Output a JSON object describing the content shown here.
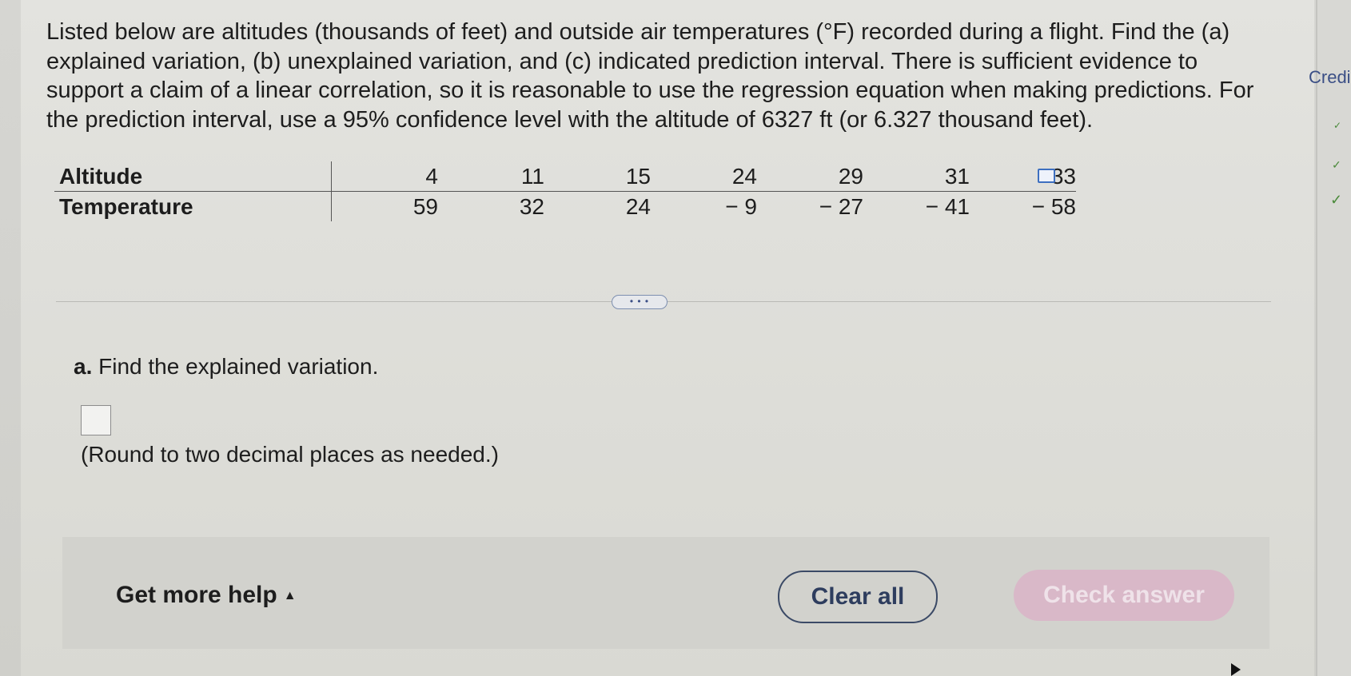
{
  "question": {
    "text": "Listed below are altitudes (thousands of feet) and outside air temperatures (°F) recorded during a flight. Find the (a) explained variation, (b) unexplained variation, and (c) indicated prediction interval. There is sufficient evidence to support a claim of a linear correlation, so it is reasonable to use the regression equation when making predictions. For the prediction interval, use a 95% confidence level with the altitude of 6327 ft (or 6.327 thousand feet)."
  },
  "table": {
    "rows": [
      {
        "label": "Altitude",
        "values": [
          "4",
          "11",
          "15",
          "24",
          "29",
          "31",
          "33"
        ]
      },
      {
        "label": "Temperature",
        "values": [
          "59",
          "32",
          "24",
          "− 9",
          "− 27",
          "− 41",
          "− 58"
        ]
      }
    ]
  },
  "more_button": {
    "label": "• • •"
  },
  "part_a": {
    "letter": "a.",
    "prompt": "Find the explained variation.",
    "answer_value": "",
    "note": "(Round to two decimal places as needed.)"
  },
  "footer": {
    "help_label": "Get more help",
    "help_arrow": "▲",
    "clear_label": "Clear all",
    "check_label": "Check answer"
  },
  "sidebar": {
    "credit_label": "Credi"
  }
}
